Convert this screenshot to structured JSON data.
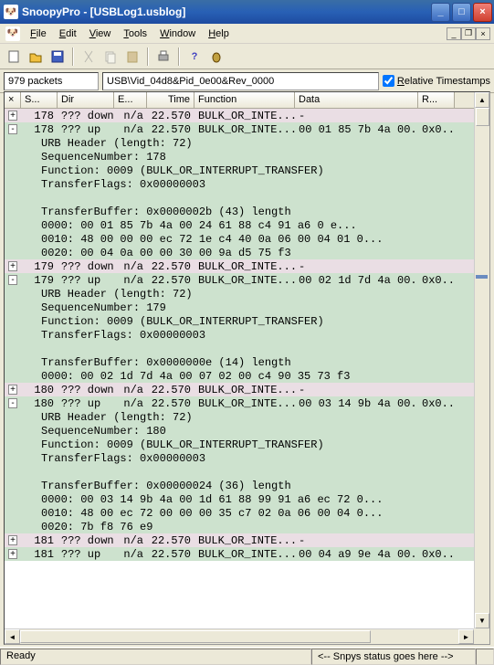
{
  "title": "SnoopyPro  -  [USBLog1.usblog]",
  "menu": {
    "file": "File",
    "edit": "Edit",
    "view": "View",
    "tools": "Tools",
    "window": "Window",
    "help": "Help"
  },
  "filterbar": {
    "packets": "979 packets",
    "url": "USB\\Vid_04d8&Pid_0e00&Rev_0000",
    "checkbox_label": "Relative Timestamps",
    "checked": true
  },
  "columns": {
    "exp": "",
    "seq": "S...",
    "dir": "Dir",
    "end": "E...",
    "time": "Time",
    "func": "Function",
    "data": "Data",
    "res": "R..."
  },
  "rows": [
    {
      "type": "summary",
      "cls": "down",
      "exp": "+",
      "seq": "178",
      "dir": "??? down",
      "end": "n/a",
      "time": "22.570",
      "func": "BULK_OR_INTE...",
      "data": "-",
      "res": ""
    },
    {
      "type": "summary",
      "cls": "up",
      "exp": "-",
      "seq": "178",
      "dir": "??? up",
      "end": "n/a",
      "time": "22.570",
      "func": "BULK_OR_INTE...",
      "data": "00 01 85 7b 4a 00...",
      "res": "0x0..."
    },
    {
      "type": "detail",
      "text": "URB Header (length: 72)"
    },
    {
      "type": "detail",
      "text": "SequenceNumber: 178"
    },
    {
      "type": "detail",
      "text": "Function: 0009 (BULK_OR_INTERRUPT_TRANSFER)"
    },
    {
      "type": "detail",
      "text": "TransferFlags: 0x00000003"
    },
    {
      "type": "detail",
      "text": ""
    },
    {
      "type": "detail",
      "text": "TransferBuffer: 0x0000002b (43) length"
    },
    {
      "type": "detail",
      "text": "0000: 00 01 85 7b 4a 00 24 61 88 c4 91 a6 0 e..."
    },
    {
      "type": "detail",
      "text": "0010: 48 00 00 00 ec 72 1e c4 40 0a 06 00 04 01 0..."
    },
    {
      "type": "detail",
      "text": "0020: 00 04 0a 00 00 30 00 9a d5 75 f3"
    },
    {
      "type": "summary",
      "cls": "down",
      "exp": "+",
      "seq": "179",
      "dir": "??? down",
      "end": "n/a",
      "time": "22.570",
      "func": "BULK_OR_INTE...",
      "data": "-",
      "res": ""
    },
    {
      "type": "summary",
      "cls": "up",
      "exp": "-",
      "seq": "179",
      "dir": "??? up",
      "end": "n/a",
      "time": "22.570",
      "func": "BULK_OR_INTE...",
      "data": "00 02 1d 7d 4a 00...",
      "res": "0x0..."
    },
    {
      "type": "detail",
      "text": "URB Header (length: 72)"
    },
    {
      "type": "detail",
      "text": "SequenceNumber: 179"
    },
    {
      "type": "detail",
      "text": "Function: 0009 (BULK_OR_INTERRUPT_TRANSFER)"
    },
    {
      "type": "detail",
      "text": "TransferFlags: 0x00000003"
    },
    {
      "type": "detail",
      "text": ""
    },
    {
      "type": "detail",
      "text": "TransferBuffer: 0x0000000e (14) length"
    },
    {
      "type": "detail",
      "text": "0000: 00 02 1d 7d 4a 00 07 02 00 c4 90 35 73 f3"
    },
    {
      "type": "summary",
      "cls": "down",
      "exp": "+",
      "seq": "180",
      "dir": "??? down",
      "end": "n/a",
      "time": "22.570",
      "func": "BULK_OR_INTE...",
      "data": "-",
      "res": ""
    },
    {
      "type": "summary",
      "cls": "up",
      "exp": "-",
      "seq": "180",
      "dir": "??? up",
      "end": "n/a",
      "time": "22.570",
      "func": "BULK_OR_INTE...",
      "data": "00 03 14 9b 4a 00...",
      "res": "0x0..."
    },
    {
      "type": "detail",
      "text": "URB Header (length: 72)"
    },
    {
      "type": "detail",
      "text": "SequenceNumber: 180"
    },
    {
      "type": "detail",
      "text": "Function: 0009 (BULK_OR_INTERRUPT_TRANSFER)"
    },
    {
      "type": "detail",
      "text": "TransferFlags: 0x00000003"
    },
    {
      "type": "detail",
      "text": ""
    },
    {
      "type": "detail",
      "text": "TransferBuffer: 0x00000024 (36) length"
    },
    {
      "type": "detail",
      "text": "0000: 00 03 14 9b 4a 00 1d 61 88 99 91 a6 ec 72 0..."
    },
    {
      "type": "detail",
      "text": "0010: 48 00 ec 72 00 00 00 35 c7 02 0a 06 00 04 0..."
    },
    {
      "type": "detail",
      "text": "0020: 7b f8 76 e9"
    },
    {
      "type": "summary",
      "cls": "down",
      "exp": "+",
      "seq": "181",
      "dir": "??? down",
      "end": "n/a",
      "time": "22.570",
      "func": "BULK_OR_INTE...",
      "data": "-",
      "res": ""
    },
    {
      "type": "summary",
      "cls": "up",
      "exp": "+",
      "seq": "181",
      "dir": "??? up",
      "end": "n/a",
      "time": "22.570",
      "func": "BULK_OR_INTE...",
      "data": "00 04 a9 9e 4a 00...",
      "res": "0x0..."
    }
  ],
  "status": {
    "ready": "Ready",
    "snpys": "<-- Snpys status goes here -->"
  }
}
